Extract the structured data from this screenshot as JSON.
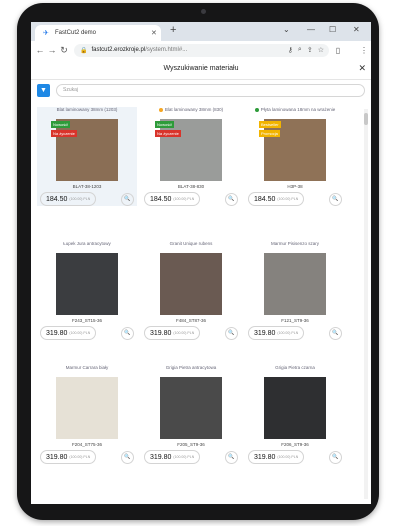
{
  "browser": {
    "tab_title": "FastCut2 demo",
    "url_host": "fastcut2.erozkroje.pl",
    "url_path": "/system.html#..."
  },
  "dialog": {
    "title": "Wyszukiwanie materiału",
    "search_placeholder": "Szukaj"
  },
  "colors": {
    "accent": "#1e88e5",
    "badge_green": "#2e9b3a",
    "badge_red": "#d9342b",
    "badge_yellow": "#f2b400"
  },
  "materials": [
    {
      "name": "Blat laminowany 38mm (1203)",
      "code": "BLAT-38-1203",
      "price": "184.50",
      "unit": "(100.00) PLN",
      "badges": [
        "Nowość!",
        "Na życzenie"
      ],
      "swatch": "#8a6e55",
      "dot": ""
    },
    {
      "name": "Blat laminowany 38mm (830)",
      "code": "BLAT-38-830",
      "price": "184.50",
      "unit": "(100.00) PLN",
      "badges": [
        "Nowość!",
        "Na życzenie"
      ],
      "swatch": "#9a9c9a",
      "dot": "#f5a623"
    },
    {
      "name": "Płyta laminowana 18mm na wrażenie",
      "code": "H3P-38",
      "price": "184.50",
      "unit": "(100.00) PLN",
      "badges": [
        "Bestseller",
        "Promocja"
      ],
      "swatch": "#8f7257",
      "dot": "#2e9b3a"
    },
    {
      "name": "Łupek Jura antracytowy",
      "code": "F243_ST15-36",
      "price": "319.80",
      "unit": "(100.00) PLN",
      "badges": [],
      "swatch": "#3b3d40",
      "dot": ""
    },
    {
      "name": "Granit Unique rubens",
      "code": "F484_ST87-36",
      "price": "319.80",
      "unit": "(100.00) PLN",
      "badges": [],
      "swatch": "#6a5a52",
      "dot": ""
    },
    {
      "name": "Marmur Pisisenzo szary",
      "code": "F121_ST9-36",
      "price": "319.80",
      "unit": "(100.00) PLN",
      "badges": [],
      "swatch": "#85827e",
      "dot": ""
    },
    {
      "name": "Marmur Carrara biały",
      "code": "F204_ST75-36",
      "price": "319.80",
      "unit": "(100.00) PLN",
      "badges": [],
      "swatch": "#e6e1d6",
      "dot": ""
    },
    {
      "name": "Grigia Pietra antracytowa",
      "code": "F205_ST9-36",
      "price": "319.80",
      "unit": "(100.00) PLN",
      "badges": [],
      "swatch": "#4a4a4a",
      "dot": ""
    },
    {
      "name": "Grigia Pietra czarna",
      "code": "F206_ST9-36",
      "price": "319.80",
      "unit": "(100.00) PLN",
      "badges": [],
      "swatch": "#2e2f31",
      "dot": ""
    }
  ]
}
